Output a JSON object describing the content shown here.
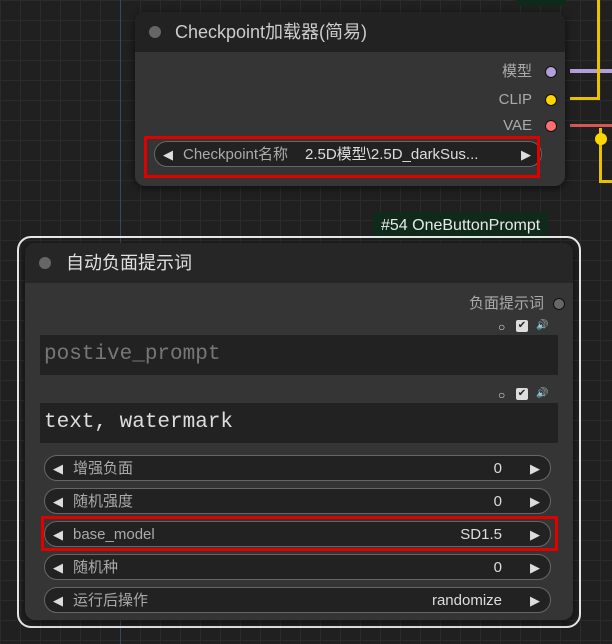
{
  "colors": {
    "model_socket": "#b39ddb",
    "clip_socket": "#ffd500",
    "vae_socket": "#ff6e6e",
    "highlight": "#e00000"
  },
  "checkpoint_node": {
    "title": "Checkpoint加载器(简易)",
    "outputs": {
      "model": "模型",
      "clip": "CLIP",
      "vae": "VAE"
    },
    "widget": {
      "label": "Checkpoint名称",
      "value": "2.5D模型\\2.5D_darkSus..."
    }
  },
  "prompt_node": {
    "badge": "#54 OneButtonPrompt",
    "title": "自动负面提示词",
    "output": "负面提示词",
    "positive_placeholder": "postive_prompt",
    "negative_text": "text, watermark",
    "widgets": [
      {
        "label": "增强负面",
        "value": "0"
      },
      {
        "label": "随机强度",
        "value": "0"
      },
      {
        "label": "base_model",
        "value": "SD1.5"
      },
      {
        "label": "随机种",
        "value": "0"
      },
      {
        "label": "运行后操作",
        "value": "randomize"
      }
    ]
  },
  "icons": {
    "circle": "○",
    "check": "✔",
    "speaker": "🔊",
    "left_arrow": "◀",
    "right_arrow": "▶"
  }
}
